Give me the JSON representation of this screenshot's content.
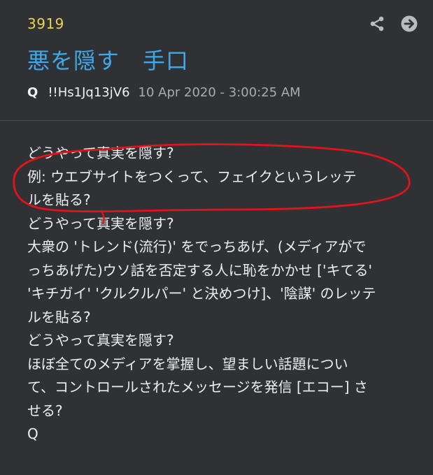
{
  "post": {
    "number": "3919",
    "title": "悪を隠す　手口",
    "author": "Q",
    "tripcode": "!!Hs1Jq13jV6",
    "date": "10 Apr 2020 - 3:00:25 AM"
  },
  "actions": [
    {
      "icon": "share-icon"
    },
    {
      "icon": "arrow-right-circle-icon"
    }
  ],
  "body_lines": [
    "どうやって真実を隠す?",
    "例: ウエブサイトをつくって、フェイクというレッテ",
    "ルを貼る?",
    "どうやって真実を隠す?",
    "大衆の 'トレンド(流行)' をでっちあげ、(メディアがで",
    "っちあげた)ウソ話を否定する人に恥をかかせ ['キてる'",
    "'キチガイ' 'クルクルパー' と決めつけ]、'陰謀' のレッテ",
    "ルを貼る?",
    "どうやって真実を隠す?",
    "ほぼ全てのメディアを掌握し、望ましい話題につい",
    "て、コントロールされたメッセージを発信 [エコー] さ",
    "せる?",
    "Q"
  ],
  "colors": {
    "background": "#2f3135",
    "post_number": "#e8d44d",
    "title": "#3fa9e8",
    "annotation": "#e0141b"
  }
}
